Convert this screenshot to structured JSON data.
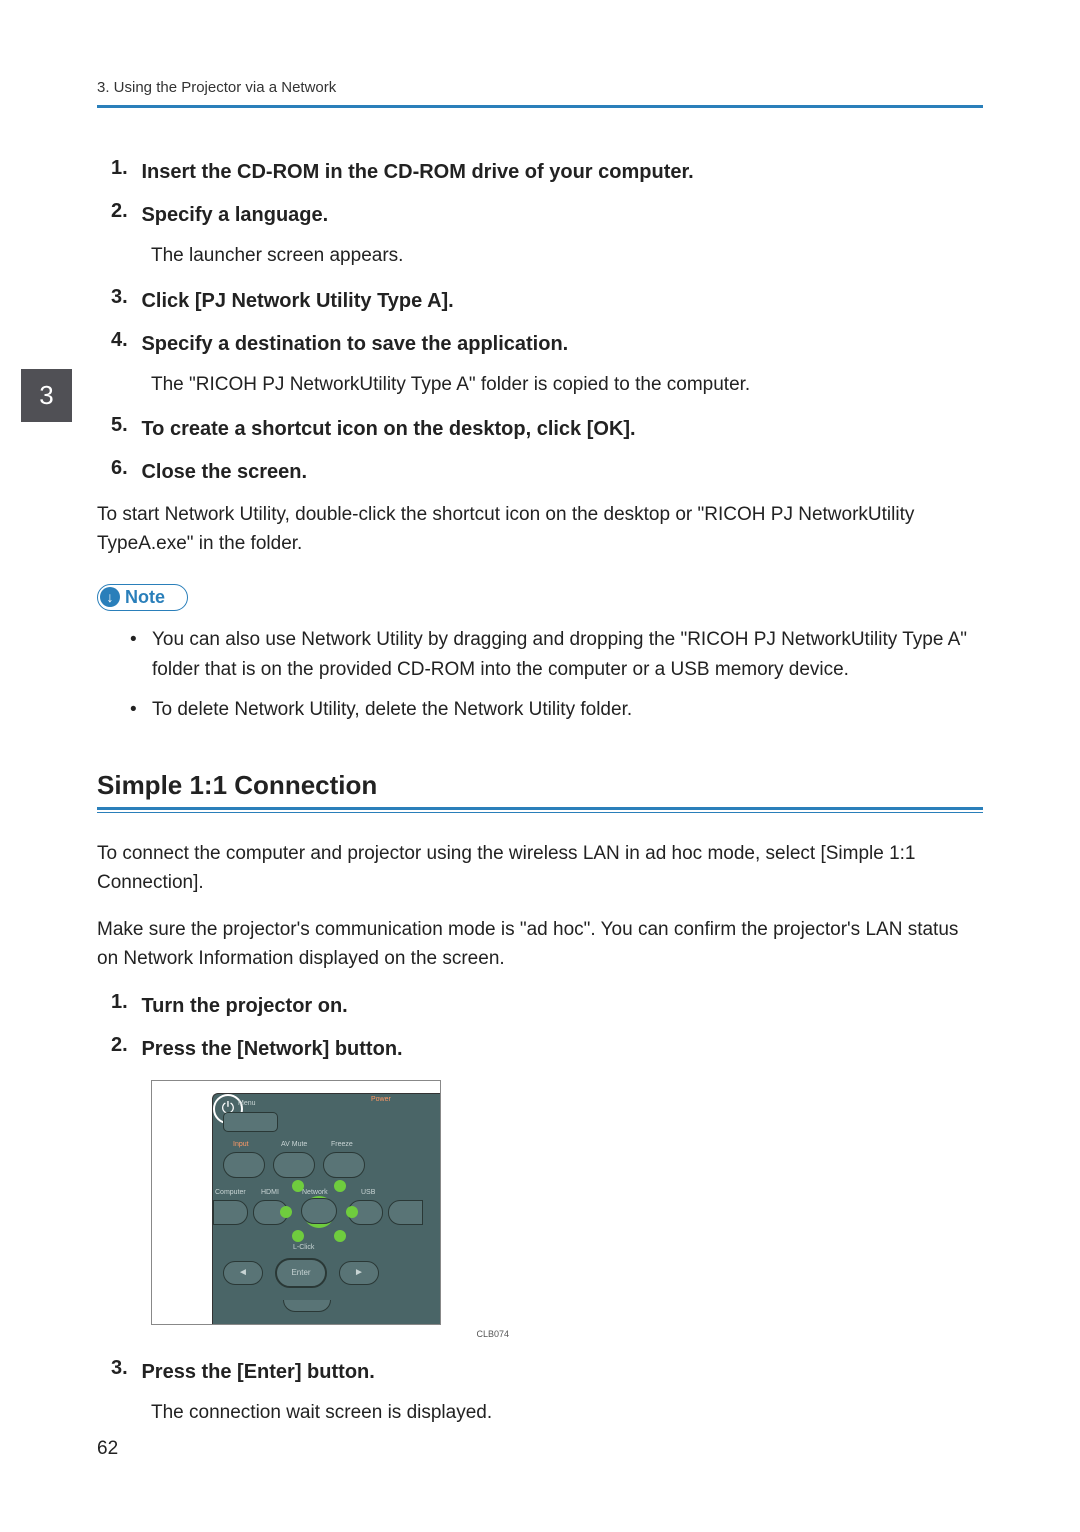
{
  "header": {
    "breadcrumb": "3. Using the Projector via a Network"
  },
  "chapter_tab": "3",
  "steps_a": [
    {
      "num": "1.",
      "text": "Insert the CD-ROM in the CD-ROM drive of your computer.",
      "desc": ""
    },
    {
      "num": "2.",
      "text": "Specify a language.",
      "desc": "The launcher screen appears."
    },
    {
      "num": "3.",
      "text": "Click [PJ Network Utility Type A].",
      "desc": ""
    },
    {
      "num": "4.",
      "text": "Specify a destination to save the application.",
      "desc": "The \"RICOH PJ NetworkUtility Type A\" folder is copied to the computer."
    },
    {
      "num": "5.",
      "text": "To create a shortcut icon on the desktop, click [OK].",
      "desc": ""
    },
    {
      "num": "6.",
      "text": "Close the screen.",
      "desc": ""
    }
  ],
  "body_para_1": "To start Network Utility, double-click the shortcut icon on the desktop or \"RICOH PJ NetworkUtility TypeA.exe\" in the folder.",
  "note": {
    "label": "Note",
    "items": [
      "You can also use Network Utility by dragging and dropping the \"RICOH PJ NetworkUtility Type A\" folder that is on the provided CD-ROM into the computer or a USB memory device.",
      "To delete Network Utility, delete the Network Utility folder."
    ]
  },
  "section": {
    "heading": "Simple 1:1 Connection",
    "para1": "To connect the computer and projector using the wireless LAN in ad hoc mode, select [Simple 1:1 Connection].",
    "para2": "Make sure the projector's communication mode is \"ad hoc\". You can confirm the projector's LAN status on Network Information displayed on the screen."
  },
  "steps_b": [
    {
      "num": "1.",
      "text": "Turn the projector on.",
      "desc": ""
    },
    {
      "num": "2.",
      "text": "Press the [Network] button.",
      "desc": ""
    }
  ],
  "remote": {
    "labels": {
      "menu": "Menu",
      "power": "Power",
      "input": "Input",
      "avmute": "AV Mute",
      "freeze": "Freeze",
      "computer": "Computer",
      "hdmi": "HDMI",
      "network": "Network",
      "usb": "USB",
      "lclick": "L-Click",
      "enter": "Enter"
    },
    "caption": "CLB074"
  },
  "steps_c": [
    {
      "num": "3.",
      "text": "Press the [Enter] button.",
      "desc": "The connection wait screen is displayed."
    }
  ],
  "page_number": "62"
}
